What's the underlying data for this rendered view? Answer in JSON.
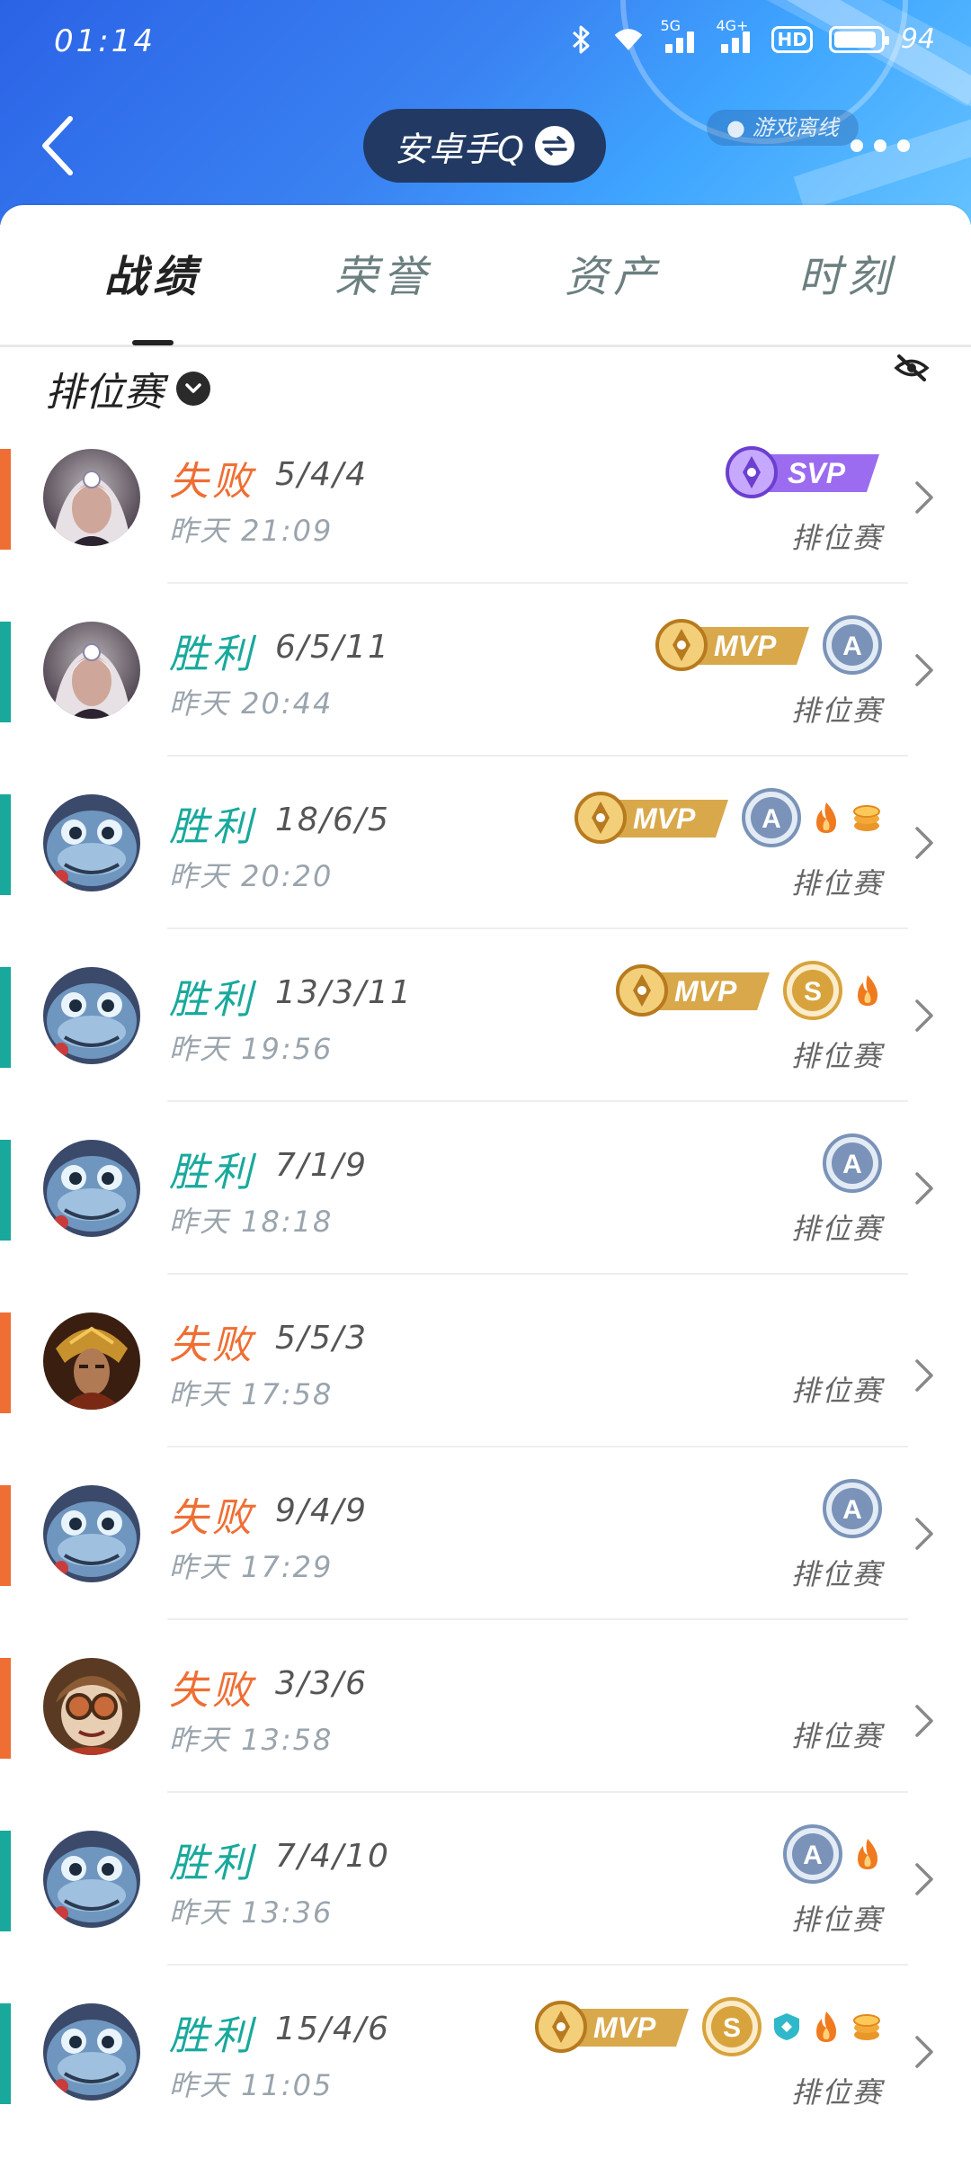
{
  "status_bar": {
    "time": "01:14",
    "battery_percent": "94",
    "network_labels": [
      "5G",
      "4G+"
    ],
    "hd_label": "HD"
  },
  "header": {
    "account_name": "安卓手Q",
    "offline_label": "游戏离线"
  },
  "tabs": [
    {
      "label": "战绩",
      "active": true
    },
    {
      "label": "荣誉",
      "active": false
    },
    {
      "label": "资产",
      "active": false
    },
    {
      "label": "时刻",
      "active": false
    }
  ],
  "filter": {
    "label": "排位赛"
  },
  "colors": {
    "win": "#18a99c",
    "loss": "#ef6e33",
    "header_start": "#2b63e6",
    "header_end": "#64c2ff",
    "pill": "#223a63",
    "mvp_gold": "#d9a84b",
    "svp_purple": "#9b6cf0",
    "grade_blue": "#7b93b8",
    "grade_gold": "#d8a33c"
  },
  "matches": [
    {
      "result": "失败",
      "outcome": "loss",
      "kda": "5/4/4",
      "time": "昨天 21:09",
      "mode": "排位赛",
      "hero_icon": "hero-silver-hair-mage",
      "badges": [
        "svp"
      ]
    },
    {
      "result": "胜利",
      "outcome": "win",
      "kda": "6/5/11",
      "time": "昨天 20:44",
      "mode": "排位赛",
      "hero_icon": "hero-silver-hair-mage",
      "badges": [
        "mvp",
        "grade-a"
      ]
    },
    {
      "result": "胜利",
      "outcome": "win",
      "kda": "18/6/5",
      "time": "昨天 20:20",
      "mode": "排位赛",
      "hero_icon": "hero-fish",
      "badges": [
        "mvp",
        "grade-a",
        "fire",
        "coins"
      ]
    },
    {
      "result": "胜利",
      "outcome": "win",
      "kda": "13/3/11",
      "time": "昨天 19:56",
      "mode": "排位赛",
      "hero_icon": "hero-fish",
      "badges": [
        "mvp",
        "grade-s",
        "fire"
      ]
    },
    {
      "result": "胜利",
      "outcome": "win",
      "kda": "7/1/9",
      "time": "昨天 18:18",
      "mode": "排位赛",
      "hero_icon": "hero-fish",
      "badges": [
        "grade-a"
      ]
    },
    {
      "result": "失败",
      "outcome": "loss",
      "kda": "5/5/3",
      "time": "昨天 17:58",
      "mode": "排位赛",
      "hero_icon": "hero-golden-warrior",
      "badges": []
    },
    {
      "result": "失败",
      "outcome": "loss",
      "kda": "9/4/9",
      "time": "昨天 17:29",
      "mode": "排位赛",
      "hero_icon": "hero-fish",
      "badges": [
        "grade-a"
      ]
    },
    {
      "result": "失败",
      "outcome": "loss",
      "kda": "3/3/6",
      "time": "昨天 13:58",
      "mode": "排位赛",
      "hero_icon": "hero-goggles",
      "badges": []
    },
    {
      "result": "胜利",
      "outcome": "win",
      "kda": "7/4/10",
      "time": "昨天 13:36",
      "mode": "排位赛",
      "hero_icon": "hero-fish",
      "badges": [
        "grade-a",
        "fire"
      ]
    },
    {
      "result": "胜利",
      "outcome": "win",
      "kda": "15/4/6",
      "time": "昨天 11:05",
      "mode": "排位赛",
      "hero_icon": "hero-fish",
      "badges": [
        "mvp",
        "grade-s",
        "shield",
        "fire",
        "coins"
      ]
    }
  ]
}
